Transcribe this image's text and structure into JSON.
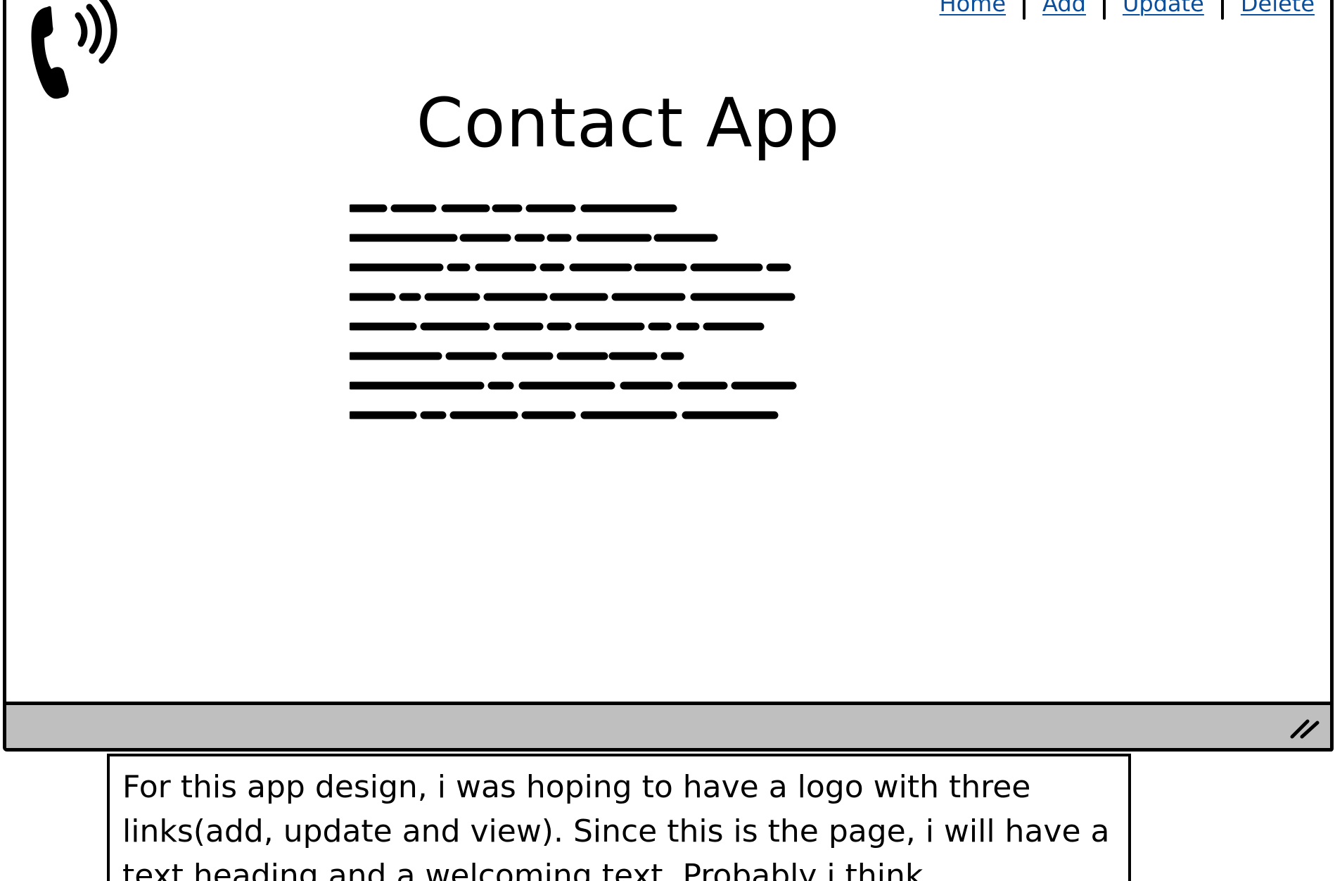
{
  "nav": {
    "links": [
      "Home",
      "Add",
      "Update",
      "Delete"
    ]
  },
  "header": {
    "title": "Contact App",
    "logo_icon": "phone-ringing-icon"
  },
  "body": {
    "welcome_text_placeholder": "scribbled lorem text block"
  },
  "annotation": {
    "text": "For this app design, i was hoping to have a logo with three links(add, update and view). Since this is the page, i will have a text heading and a welcoming text. Probably i think"
  },
  "colors": {
    "link": "#0b4f9c",
    "statusbar": "#bfbfbf",
    "ink": "#000000"
  }
}
